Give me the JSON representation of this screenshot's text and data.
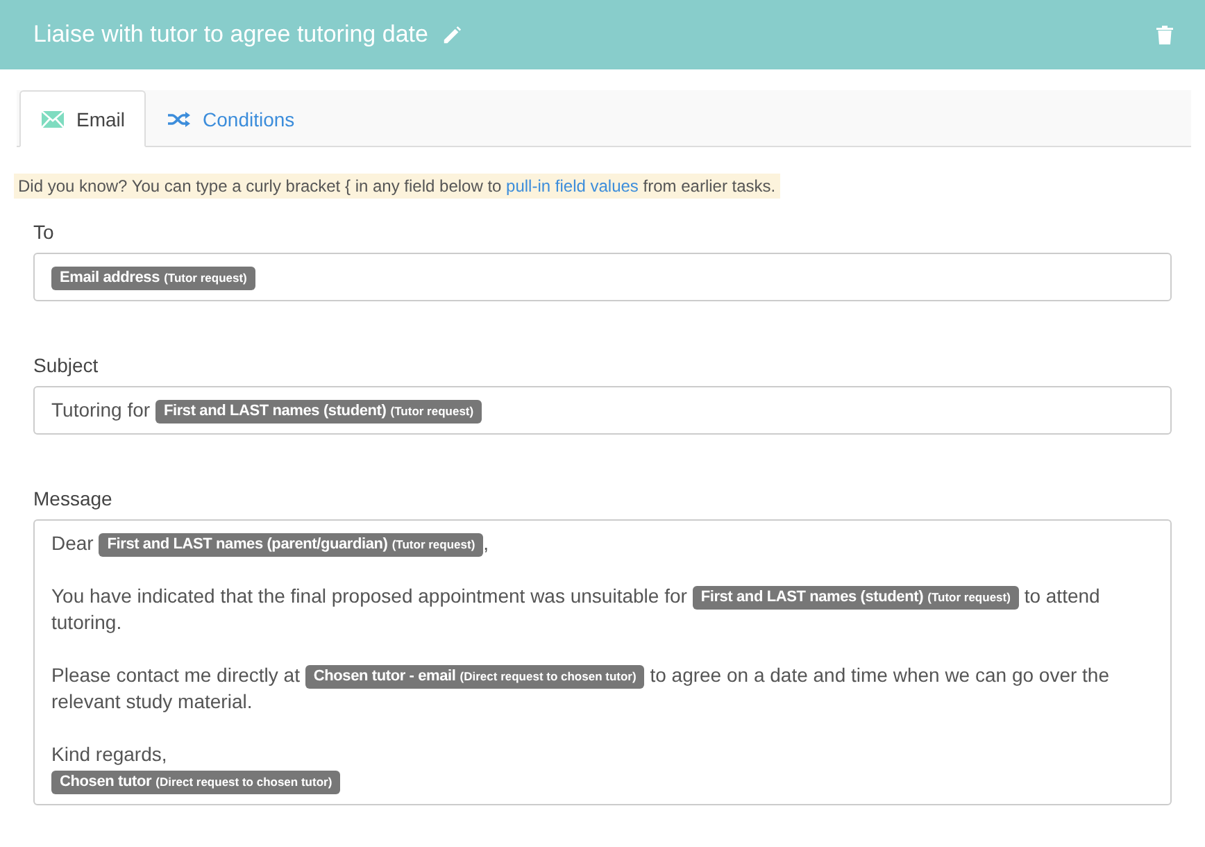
{
  "header": {
    "title": "Liaise with tutor to agree tutoring date"
  },
  "tabs": [
    {
      "label": "Email",
      "selected": true
    },
    {
      "label": "Conditions",
      "selected": false
    }
  ],
  "tip": {
    "before": "Did you know? You can type a curly bracket { in any field below to ",
    "link": "pull-in field values",
    "after": " from earlier tasks."
  },
  "fields": [
    {
      "label": "To",
      "paragraphs": [
        [
          {
            "kind": "tag",
            "name": "Email address",
            "source": "(Tutor request)"
          }
        ]
      ]
    },
    {
      "label": "Subject",
      "paragraphs": [
        [
          {
            "kind": "text",
            "text": "Tutoring for "
          },
          {
            "kind": "tag",
            "name": "First and LAST names (student)",
            "source": "(Tutor request)"
          }
        ]
      ]
    },
    {
      "label": "Message",
      "paragraphs": [
        [
          {
            "kind": "text",
            "text": "Dear "
          },
          {
            "kind": "tag",
            "name": "First and LAST names (parent/guardian)",
            "source": "(Tutor request)"
          },
          {
            "kind": "text",
            "text": ","
          }
        ],
        [
          {
            "kind": "text",
            "text": "You have indicated that the final proposed appointment was unsuitable for "
          },
          {
            "kind": "tag",
            "name": "First and LAST names (student)",
            "source": "(Tutor request)"
          },
          {
            "kind": "text",
            "text": " to attend"
          },
          {
            "kind": "break"
          },
          {
            "kind": "text",
            "text": "tutoring."
          }
        ],
        [
          {
            "kind": "text",
            "text": "Please contact me directly at "
          },
          {
            "kind": "tag",
            "name": "Chosen tutor - email",
            "source": "(Direct request to chosen tutor)"
          },
          {
            "kind": "text",
            "text": " to agree on a date and time when we can go over the"
          },
          {
            "kind": "break"
          },
          {
            "kind": "text",
            "text": "relevant study material."
          }
        ],
        [
          {
            "kind": "text",
            "text": "Kind regards,"
          },
          {
            "kind": "break"
          },
          {
            "kind": "tag",
            "name": "Chosen tutor",
            "source": "(Direct request to chosen tutor)"
          }
        ]
      ]
    }
  ]
}
